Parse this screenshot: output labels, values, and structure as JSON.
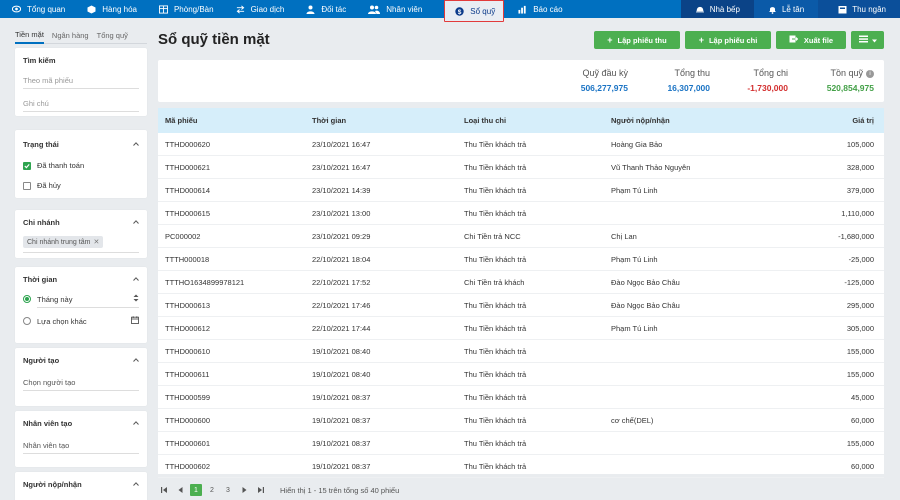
{
  "nav": {
    "items": [
      {
        "label": "Tổng quan",
        "icon": "eye-icon"
      },
      {
        "label": "Hàng hóa",
        "icon": "box-icon"
      },
      {
        "label": "Phòng/Bàn",
        "icon": "table-icon"
      },
      {
        "label": "Giao dịch",
        "icon": "exchange-icon"
      },
      {
        "label": "Đối tác",
        "icon": "person-icon"
      },
      {
        "label": "Nhân viên",
        "icon": "users-icon"
      },
      {
        "label": "Sổ quỹ",
        "icon": "fund-icon"
      },
      {
        "label": "Báo cáo",
        "icon": "chart-icon"
      }
    ],
    "right": [
      {
        "label": "Nhà bếp",
        "icon": "chef-icon"
      },
      {
        "label": "Lễ tân",
        "icon": "bell-icon"
      },
      {
        "label": "Thu ngân",
        "icon": "cashier-icon"
      }
    ]
  },
  "left": {
    "tabs": [
      "Tiền mặt",
      "Ngân hàng",
      "Tổng quỹ"
    ],
    "search": {
      "title": "Tìm kiếm",
      "code_placeholder": "Theo mã phiếu",
      "note_placeholder": "Ghi chú"
    },
    "status": {
      "title": "Trạng thái",
      "options": [
        {
          "label": "Đã thanh toán",
          "checked": true
        },
        {
          "label": "Đã hủy",
          "checked": false
        }
      ]
    },
    "branch": {
      "title": "Chi nhánh",
      "chip": "Chi nhánh trung tâm"
    },
    "time": {
      "title": "Thời gian",
      "this_month": "Tháng này",
      "other": "Lựa chọn khác"
    },
    "creator": {
      "title": "Người tạo",
      "placeholder": "Chọn người tạo"
    },
    "creator_staff": {
      "title": "Nhân viên tạo",
      "placeholder": "Nhân viên tạo"
    },
    "payer": {
      "title": "Người nộp/nhận"
    }
  },
  "main": {
    "title": "Sổ quỹ tiền mặt",
    "buttons": {
      "receipt": "Lập phiếu thu",
      "payment": "Lập phiếu chi",
      "export": "Xuất file"
    },
    "summary": [
      {
        "label": "Quỹ đầu kỳ",
        "value": "506,277,975",
        "color": "#1a73c4"
      },
      {
        "label": "Tổng thu",
        "value": "16,307,000",
        "color": "#1a73c4"
      },
      {
        "label": "Tổng chi",
        "value": "-1,730,000",
        "color": "#d32f2f"
      },
      {
        "label": "Tồn quỹ",
        "value": "520,854,975",
        "color": "#43a047"
      }
    ],
    "columns": [
      "Mã phiếu",
      "Thời gian",
      "Loại thu chi",
      "Người nộp/nhận",
      "Giá trị"
    ],
    "rows": [
      [
        "TTHD000620",
        "23/10/2021 16:47",
        "Thu Tiền khách trả",
        "Hoàng Gia Bảo",
        "105,000"
      ],
      [
        "TTHD000621",
        "23/10/2021 16:47",
        "Thu Tiền khách trả",
        "Vũ Thanh Thảo Nguyên",
        "328,000"
      ],
      [
        "TTHD000614",
        "23/10/2021 14:39",
        "Thu Tiền khách trả",
        "Phạm Tú Linh",
        "379,000"
      ],
      [
        "TTHD000615",
        "23/10/2021 13:00",
        "Thu Tiền khách trả",
        "",
        "1,110,000"
      ],
      [
        "PC000002",
        "23/10/2021 09:29",
        "Chi Tiền trả NCC",
        "Chị Lan",
        "-1,680,000"
      ],
      [
        "TTTH000018",
        "22/10/2021 18:04",
        "Thu Tiền khách trả",
        "Phạm Tú Linh",
        "-25,000"
      ],
      [
        "TTTHO1634899978121",
        "22/10/2021 17:52",
        "Chi Tiền trả khách",
        "Đào Ngọc Bảo Châu",
        "-125,000"
      ],
      [
        "TTHD000613",
        "22/10/2021 17:46",
        "Thu Tiền khách trả",
        "Đào Ngọc Bảo Châu",
        "295,000"
      ],
      [
        "TTHD000612",
        "22/10/2021 17:44",
        "Thu Tiền khách trả",
        "Phạm Tú Linh",
        "305,000"
      ],
      [
        "TTHD000610",
        "19/10/2021 08:40",
        "Thu Tiền khách trả",
        "",
        "155,000"
      ],
      [
        "TTHD000611",
        "19/10/2021 08:40",
        "Thu Tiền khách trả",
        "",
        "155,000"
      ],
      [
        "TTHD000599",
        "19/10/2021 08:37",
        "Thu Tiền khách trả",
        "",
        "45,000"
      ],
      [
        "TTHD000600",
        "19/10/2021 08:37",
        "Thu Tiền khách trả",
        "cơ chế(DEL)",
        "60,000"
      ],
      [
        "TTHD000601",
        "19/10/2021 08:37",
        "Thu Tiền khách trả",
        "",
        "155,000"
      ],
      [
        "TTHD000602",
        "19/10/2021 08:37",
        "Thu Tiền khách trả",
        "",
        "60,000"
      ]
    ],
    "pager": {
      "pages": [
        "1",
        "2",
        "3"
      ],
      "info": "Hiển thị 1 - 15 trên tổng số 40 phiếu"
    }
  }
}
